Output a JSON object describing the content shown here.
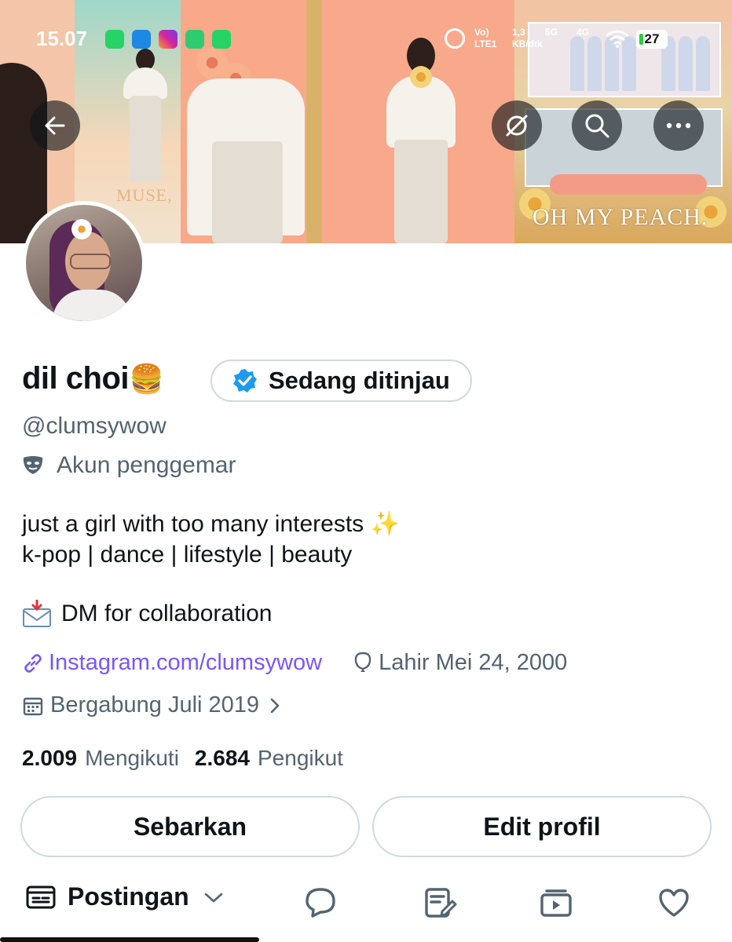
{
  "status_bar": {
    "time": "15.07",
    "network_label_1": "Vo)",
    "network_label_2": "LTE1",
    "speed": "1,3",
    "speed_unit": "KB/dtk",
    "signal_5g": "5G",
    "signal_4g": "4G",
    "battery": "27"
  },
  "banner": {
    "text_left": "MUSE,",
    "text_right": "OH MY PEACH."
  },
  "profile": {
    "name": "dil choi",
    "name_emoji": "🍔",
    "verification_pill": "Sedang ditinjau",
    "handle": "@clumsywow",
    "category": "Akun penggemar",
    "bio_line1": "just a girl with too many interests ✨",
    "bio_line2": "k-pop | dance | lifestyle | beauty",
    "dm_line": "DM for collaboration",
    "link": "Instagram.com/clumsywow",
    "birth": "Lahir Mei 24, 2000",
    "joined": "Bergabung Juli 2019",
    "following_count": "2.009",
    "following_label": "Mengikuti",
    "followers_count": "2.684",
    "followers_label": "Pengikut"
  },
  "actions": {
    "share_label": "Sebarkan",
    "edit_label": "Edit profil"
  },
  "tabs": {
    "posts_label": "Postingan"
  },
  "colors": {
    "link": "#7856ff",
    "muted": "#536471",
    "verified": "#1d9bf0",
    "border": "#cfd9de"
  }
}
